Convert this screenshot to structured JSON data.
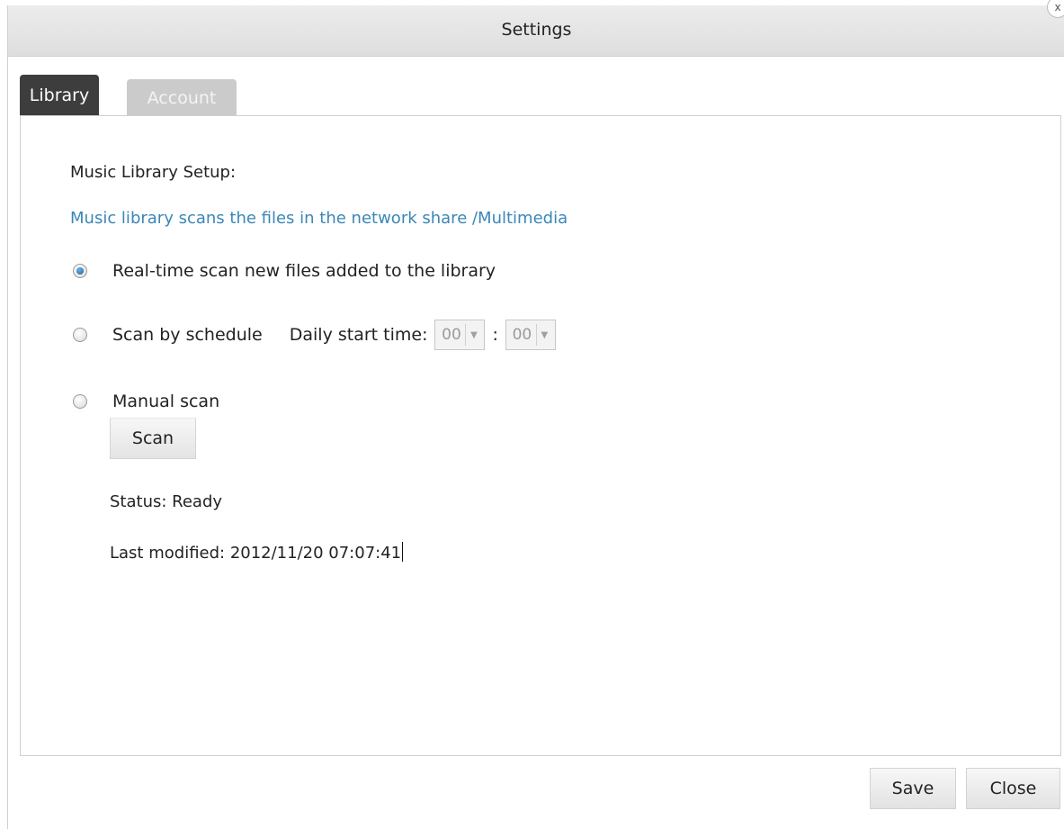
{
  "window": {
    "title": "Settings",
    "close_glyph": "x"
  },
  "tabs": [
    {
      "label": "Library",
      "active": true
    },
    {
      "label": "Account",
      "active": false
    }
  ],
  "library": {
    "section_label": "Music Library Setup:",
    "info_text": "Music library scans the files in the network share /Multimedia",
    "options": [
      {
        "label": "Real-time scan new files added to the library",
        "checked": true
      },
      {
        "label": "Scan by schedule",
        "checked": false
      },
      {
        "label": "Manual scan",
        "checked": false
      }
    ],
    "schedule": {
      "daily_start_label": "Daily start time:",
      "hour": "00",
      "separator": ":",
      "minute": "00"
    },
    "scan_button": "Scan",
    "status": "Status: Ready",
    "last_modified": "Last modified: 2012/11/20 07:07:41"
  },
  "footer": {
    "save_label": "Save",
    "close_label": "Close"
  },
  "colors": {
    "accent_link": "#3a87b8",
    "active_tab": "#3d3d3d",
    "inactive_tab": "#cbcbcb"
  }
}
